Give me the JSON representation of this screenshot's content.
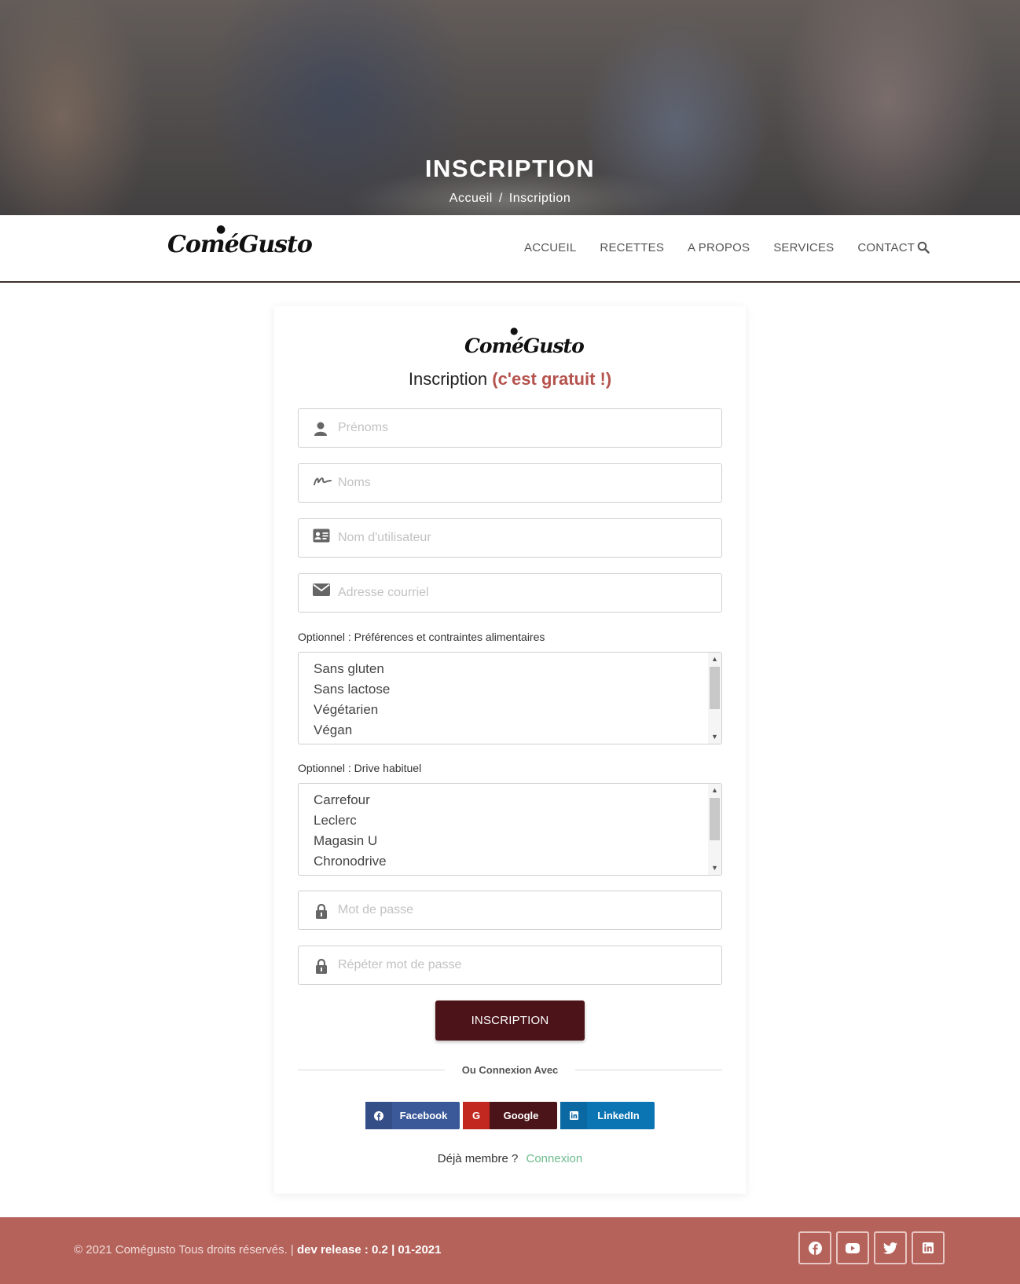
{
  "hero": {
    "title": "INSCRIPTION",
    "breadcrumb": {
      "home": "Accueil",
      "separator": "/",
      "current": "Inscription"
    }
  },
  "navbar": {
    "brand": "ComéGusto",
    "links": [
      "ACCUEIL",
      "RECETTES",
      "A PROPOS",
      "SERVICES",
      "CONTACT"
    ],
    "search_icon": "search-icon"
  },
  "form": {
    "brand": "ComéGusto",
    "heading": "Inscription",
    "heading_accent": "(c'est gratuit !)",
    "fields": {
      "first_name": {
        "placeholder": "Prénoms",
        "icon": "user-icon",
        "value": ""
      },
      "last_name": {
        "placeholder": "Noms",
        "icon": "signature-icon",
        "value": ""
      },
      "username": {
        "placeholder": "Nom d'utilisateur",
        "icon": "id-card-icon",
        "value": ""
      },
      "email": {
        "placeholder": "Adresse courriel",
        "icon": "envelope-icon",
        "value": ""
      },
      "password": {
        "placeholder": "Mot de passe",
        "icon": "lock-icon",
        "value": ""
      },
      "password_repeat": {
        "placeholder": "Répéter mot de passe",
        "icon": "lock-icon",
        "value": ""
      }
    },
    "preferences": {
      "label": "Optionnel : Préférences et contraintes alimentaires",
      "options": [
        "Sans gluten",
        "Sans lactose",
        "Végétarien",
        "Végan"
      ]
    },
    "drive": {
      "label": "Optionnel : Drive habituel",
      "options": [
        "Carrefour",
        "Leclerc",
        "Magasin U",
        "Chronodrive"
      ]
    },
    "submit_label": "INSCRIPTION",
    "divider_text": "Ou Connexion Avec",
    "social": {
      "facebook": "Facebook",
      "google": "Google",
      "linkedin": "LinkedIn"
    },
    "already_member": "Déjà membre ?",
    "login_link": "Connexion"
  },
  "footer": {
    "copyright": "© 2021 Comégusto Tous droits réservés. |",
    "release": "dev release : 0.2 | 01-2021",
    "icons": [
      "facebook-icon",
      "youtube-icon",
      "twitter-icon",
      "linkedin-icon"
    ]
  },
  "colors": {
    "brand_dark": "#4c1419",
    "accent": "#b5534e",
    "footer": "#b5625b",
    "link_green": "#6dbb8d",
    "facebook": "#3b5998",
    "google_red": "#c2281f",
    "linkedin": "#0b74b3"
  }
}
